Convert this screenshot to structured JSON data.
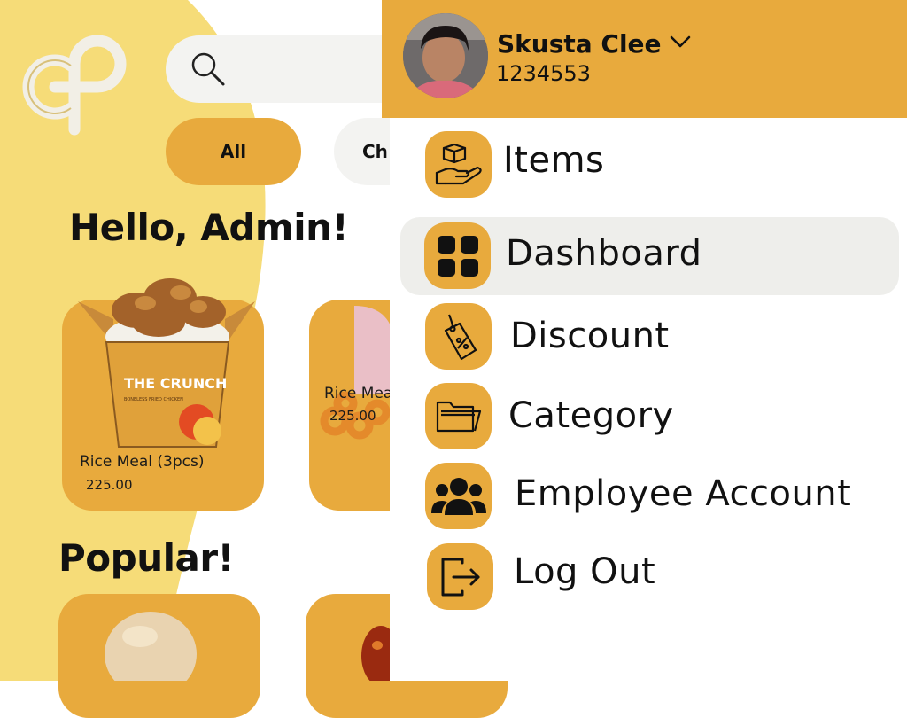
{
  "app": {
    "search": {
      "placeholder": ""
    },
    "filters": [
      {
        "label": "All",
        "selected": true
      },
      {
        "label": "Ch",
        "selected": false
      }
    ],
    "greeting": "Hello, Admin!",
    "products": [
      {
        "name": "Rice Meal (3pcs)",
        "price": "225.00",
        "box_brand": "THE CRUNCH",
        "box_tagline": "BONELESS FRIED CHICKEN"
      },
      {
        "name": "Rice Mea",
        "price": "225.00"
      }
    ],
    "popular_title": "Popular!"
  },
  "user": {
    "name": "Skusta Clee",
    "id": "1234553"
  },
  "menu": {
    "items": [
      {
        "label": "Items",
        "icon": "hand-box-icon",
        "active": false
      },
      {
        "label": "Dashboard",
        "icon": "grid-icon",
        "active": true
      },
      {
        "label": "Discount",
        "icon": "tag-percent-icon",
        "active": false
      },
      {
        "label": "Category",
        "icon": "folder-icon",
        "active": false
      },
      {
        "label": "Employee Account",
        "icon": "users-icon",
        "active": false
      },
      {
        "label": "Log Out",
        "icon": "logout-icon",
        "active": false
      }
    ]
  },
  "colors": {
    "accent": "#e8aa3d",
    "cream": "#f6dc78",
    "active_bg": "#eeeeeb",
    "chip_bg": "#f3f3f1"
  }
}
